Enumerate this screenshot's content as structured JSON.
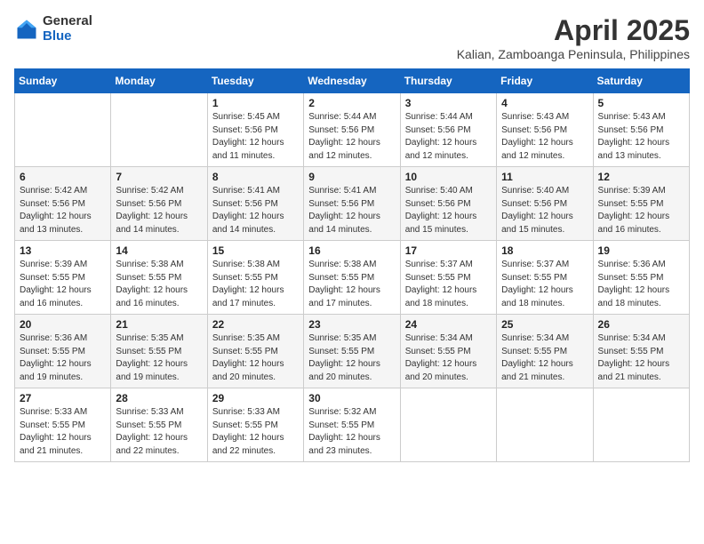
{
  "logo": {
    "general": "General",
    "blue": "Blue"
  },
  "header": {
    "title": "April 2025",
    "subtitle": "Kalian, Zamboanga Peninsula, Philippines"
  },
  "weekdays": [
    "Sunday",
    "Monday",
    "Tuesday",
    "Wednesday",
    "Thursday",
    "Friday",
    "Saturday"
  ],
  "weeks": [
    [
      {
        "day": "",
        "info": ""
      },
      {
        "day": "",
        "info": ""
      },
      {
        "day": "1",
        "info": "Sunrise: 5:45 AM\nSunset: 5:56 PM\nDaylight: 12 hours\nand 11 minutes."
      },
      {
        "day": "2",
        "info": "Sunrise: 5:44 AM\nSunset: 5:56 PM\nDaylight: 12 hours\nand 12 minutes."
      },
      {
        "day": "3",
        "info": "Sunrise: 5:44 AM\nSunset: 5:56 PM\nDaylight: 12 hours\nand 12 minutes."
      },
      {
        "day": "4",
        "info": "Sunrise: 5:43 AM\nSunset: 5:56 PM\nDaylight: 12 hours\nand 12 minutes."
      },
      {
        "day": "5",
        "info": "Sunrise: 5:43 AM\nSunset: 5:56 PM\nDaylight: 12 hours\nand 13 minutes."
      }
    ],
    [
      {
        "day": "6",
        "info": "Sunrise: 5:42 AM\nSunset: 5:56 PM\nDaylight: 12 hours\nand 13 minutes."
      },
      {
        "day": "7",
        "info": "Sunrise: 5:42 AM\nSunset: 5:56 PM\nDaylight: 12 hours\nand 14 minutes."
      },
      {
        "day": "8",
        "info": "Sunrise: 5:41 AM\nSunset: 5:56 PM\nDaylight: 12 hours\nand 14 minutes."
      },
      {
        "day": "9",
        "info": "Sunrise: 5:41 AM\nSunset: 5:56 PM\nDaylight: 12 hours\nand 14 minutes."
      },
      {
        "day": "10",
        "info": "Sunrise: 5:40 AM\nSunset: 5:56 PM\nDaylight: 12 hours\nand 15 minutes."
      },
      {
        "day": "11",
        "info": "Sunrise: 5:40 AM\nSunset: 5:56 PM\nDaylight: 12 hours\nand 15 minutes."
      },
      {
        "day": "12",
        "info": "Sunrise: 5:39 AM\nSunset: 5:55 PM\nDaylight: 12 hours\nand 16 minutes."
      }
    ],
    [
      {
        "day": "13",
        "info": "Sunrise: 5:39 AM\nSunset: 5:55 PM\nDaylight: 12 hours\nand 16 minutes."
      },
      {
        "day": "14",
        "info": "Sunrise: 5:38 AM\nSunset: 5:55 PM\nDaylight: 12 hours\nand 16 minutes."
      },
      {
        "day": "15",
        "info": "Sunrise: 5:38 AM\nSunset: 5:55 PM\nDaylight: 12 hours\nand 17 minutes."
      },
      {
        "day": "16",
        "info": "Sunrise: 5:38 AM\nSunset: 5:55 PM\nDaylight: 12 hours\nand 17 minutes."
      },
      {
        "day": "17",
        "info": "Sunrise: 5:37 AM\nSunset: 5:55 PM\nDaylight: 12 hours\nand 18 minutes."
      },
      {
        "day": "18",
        "info": "Sunrise: 5:37 AM\nSunset: 5:55 PM\nDaylight: 12 hours\nand 18 minutes."
      },
      {
        "day": "19",
        "info": "Sunrise: 5:36 AM\nSunset: 5:55 PM\nDaylight: 12 hours\nand 18 minutes."
      }
    ],
    [
      {
        "day": "20",
        "info": "Sunrise: 5:36 AM\nSunset: 5:55 PM\nDaylight: 12 hours\nand 19 minutes."
      },
      {
        "day": "21",
        "info": "Sunrise: 5:35 AM\nSunset: 5:55 PM\nDaylight: 12 hours\nand 19 minutes."
      },
      {
        "day": "22",
        "info": "Sunrise: 5:35 AM\nSunset: 5:55 PM\nDaylight: 12 hours\nand 20 minutes."
      },
      {
        "day": "23",
        "info": "Sunrise: 5:35 AM\nSunset: 5:55 PM\nDaylight: 12 hours\nand 20 minutes."
      },
      {
        "day": "24",
        "info": "Sunrise: 5:34 AM\nSunset: 5:55 PM\nDaylight: 12 hours\nand 20 minutes."
      },
      {
        "day": "25",
        "info": "Sunrise: 5:34 AM\nSunset: 5:55 PM\nDaylight: 12 hours\nand 21 minutes."
      },
      {
        "day": "26",
        "info": "Sunrise: 5:34 AM\nSunset: 5:55 PM\nDaylight: 12 hours\nand 21 minutes."
      }
    ],
    [
      {
        "day": "27",
        "info": "Sunrise: 5:33 AM\nSunset: 5:55 PM\nDaylight: 12 hours\nand 21 minutes."
      },
      {
        "day": "28",
        "info": "Sunrise: 5:33 AM\nSunset: 5:55 PM\nDaylight: 12 hours\nand 22 minutes."
      },
      {
        "day": "29",
        "info": "Sunrise: 5:33 AM\nSunset: 5:55 PM\nDaylight: 12 hours\nand 22 minutes."
      },
      {
        "day": "30",
        "info": "Sunrise: 5:32 AM\nSunset: 5:55 PM\nDaylight: 12 hours\nand 23 minutes."
      },
      {
        "day": "",
        "info": ""
      },
      {
        "day": "",
        "info": ""
      },
      {
        "day": "",
        "info": ""
      }
    ]
  ]
}
